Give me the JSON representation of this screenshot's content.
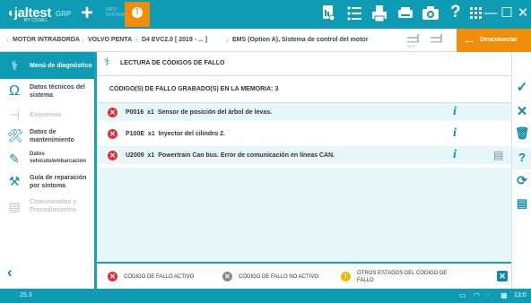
{
  "app": {
    "logo": "jaltest",
    "logo_sub": "BY COJALI",
    "group": "GRP",
    "small_label": "INFO SYSTEM",
    "alert_glyph": "!"
  },
  "toolbar": {
    "icons": [
      "report-icon",
      "list-icon",
      "print-icon",
      "printer-icon",
      "camera-icon",
      "help-icon",
      "apps-icon"
    ],
    "window_controls": [
      "minimize-icon",
      "maximize-icon",
      "close-icon"
    ],
    "help_glyph": "?"
  },
  "breadcrumb": [
    "MOTOR INTRABORDA",
    "VOLVO PENTA",
    "D4 EVC2.0 [ 2019 - ... ]",
    "EMS (Option A), Sistema de control del motor"
  ],
  "test_badges": [
    "TEST",
    "TEST"
  ],
  "disconnect_label": "Desconectar",
  "sidebar": {
    "items": [
      {
        "label": "Menú de diagnóstico",
        "icon": "diagnostic-menu-icon",
        "state": "active"
      },
      {
        "label": "Datos técnicos del sistema",
        "icon": "technical-data-icon",
        "state": "normal"
      },
      {
        "label": "Esquemas",
        "icon": "schematics-icon",
        "state": "disabled"
      },
      {
        "label": "Datos de mantenimiento",
        "icon": "maintenance-icon",
        "state": "normal"
      },
      {
        "label": "Datos vehículo/embarcación",
        "icon": "vehicle-data-icon",
        "state": "normal"
      },
      {
        "label": "Guía de reparación por síntoma",
        "icon": "repair-guide-icon",
        "state": "normal"
      },
      {
        "label": "Comunicados y Procedimientos",
        "icon": "bulletins-icon",
        "state": "disabled"
      }
    ],
    "back_icon": "back-icon"
  },
  "main": {
    "title": "LECTURA DE CÓDIGOS DE FALLO",
    "header": "CÓDIGO(S) DE FALLO GRABADO(S) EN LA MEMORIA: 3",
    "faults": [
      {
        "code": "P0016",
        "count": "x1",
        "description": "Sensor de posición del árbol de levas."
      },
      {
        "code": "P100E",
        "count": "x1",
        "description": "Inyector del cilindro 2."
      },
      {
        "code": "U2009",
        "count": "x1",
        "description": "Powertrain Can bus. Error de comunicación en líneas CAN."
      }
    ],
    "info_glyph": "i"
  },
  "legend": {
    "active": "CÓDIGO DE FALLO ACTIVO",
    "inactive": "CÓDIGO DE FALLO NO ACTIVO",
    "other": "OTROS ESTADOS DEL CÓDIGO DE FALLO"
  },
  "right_actions": [
    "confirm-icon",
    "cancel-icon",
    "delete-icon",
    "question-icon",
    "history-icon",
    "extra-icon"
  ],
  "status": {
    "version": "25.3",
    "time": "13:0"
  },
  "colors": {
    "accent": "#0f9bb3",
    "orange": "#f28d0a",
    "red": "#e02f3d",
    "row_bg": "#e6f6fa"
  }
}
